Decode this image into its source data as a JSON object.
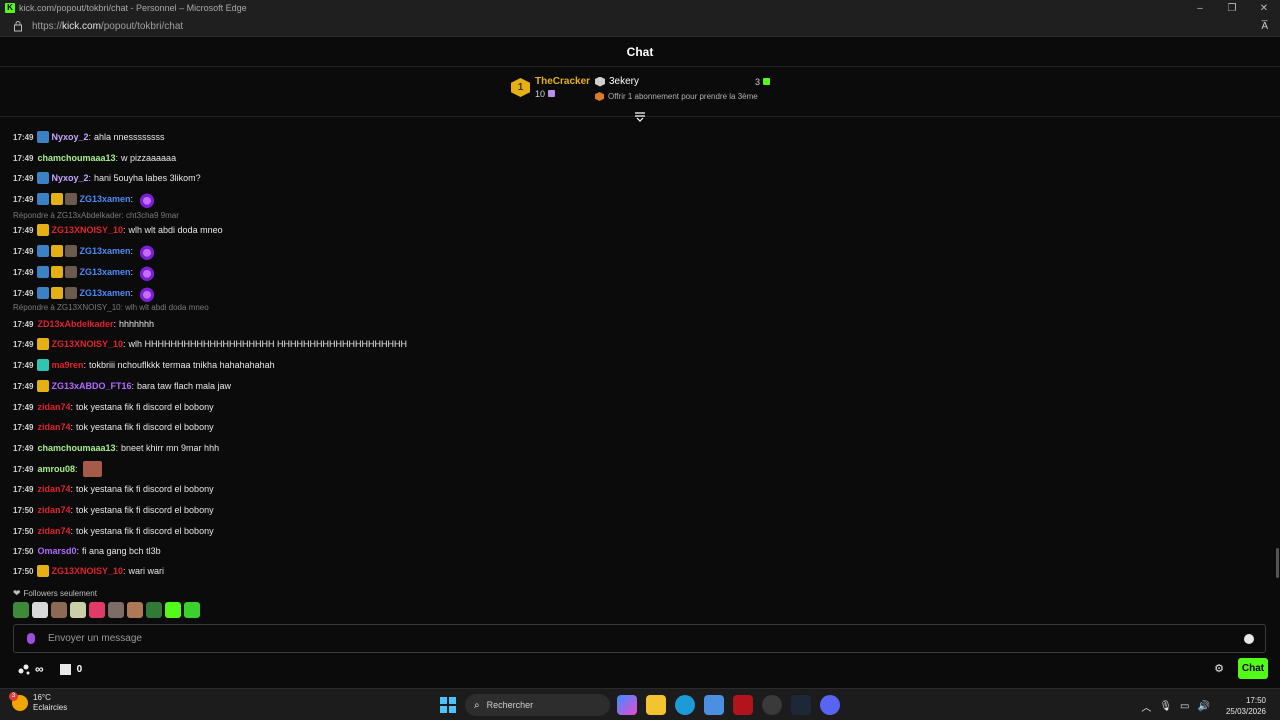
{
  "window": {
    "title": "kick.com/popout/tokbri/chat - Personnel – Microsoft Edge",
    "url_prefix": "https://",
    "url_host": "kick.com",
    "url_path": "/popout/tokbri/chat",
    "read_aloud": "A̅"
  },
  "header": {
    "title": "Chat"
  },
  "pinned": {
    "rank": "1",
    "top_user": "TheCracker",
    "top_count": "10",
    "second_user": "3ekery",
    "second_count": "3",
    "offer_text": "Offrir 1 abonnement pour prendre la 3ème"
  },
  "messages": [
    {
      "time": "17:49",
      "user": "Nyxoy_2",
      "color": "#c6a6ff",
      "badges": [
        "sub"
      ],
      "text": "ahla nnessssssss"
    },
    {
      "time": "17:49",
      "user": "chamchoumaaa13",
      "color": "#a6f08a",
      "badges": [],
      "text": "w pizzaaaaaa"
    },
    {
      "time": "17:49",
      "user": "Nyxoy_2",
      "color": "#c6a6ff",
      "badges": [
        "sub"
      ],
      "text": "hani 5ouyha labes 3likom?"
    },
    {
      "time": "17:49",
      "user": "ZG13xamen",
      "color": "#4c8bf5",
      "badges": [
        "sub",
        "crown",
        "av"
      ],
      "text": "",
      "emote": true
    },
    {
      "reply": "Répondre à ZG13xAbdelkader: cht3cha9 9mar"
    },
    {
      "time": "17:49",
      "user": "ZG13XNOISY_10",
      "color": "#e0242b",
      "badges": [
        "crown"
      ],
      "text": "wlh wlt abdi doda mneo"
    },
    {
      "time": "17:49",
      "user": "ZG13xamen",
      "color": "#4c8bf5",
      "badges": [
        "sub",
        "crown",
        "av"
      ],
      "text": "",
      "emote": true
    },
    {
      "time": "17:49",
      "user": "ZG13xamen",
      "color": "#4c8bf5",
      "badges": [
        "sub",
        "crown",
        "av"
      ],
      "text": "",
      "emote": true
    },
    {
      "time": "17:49",
      "user": "ZG13xamen",
      "color": "#4c8bf5",
      "badges": [
        "sub",
        "crown",
        "av"
      ],
      "text": "",
      "emote": true
    },
    {
      "reply": "Répondre à ZG13XNOISY_10: wlh wlt abdi doda mneo"
    },
    {
      "time": "17:49",
      "user": "ZD13xAbdelkader",
      "color": "#e0242b",
      "badges": [],
      "text": "hhhhhhh"
    },
    {
      "time": "17:49",
      "user": "ZG13XNOISY_10",
      "color": "#e0242b",
      "badges": [
        "crown"
      ],
      "text": "wlh HHHHHHHHHHHHHHHHHHHH HHHHHHHHHHHHHHHHHHHH"
    },
    {
      "time": "17:49",
      "user": "ma9ren",
      "color": "#e0242b",
      "badges": [
        "mod"
      ],
      "text": "tokbriii nchouflkkk termaa tnikha hahahahahah"
    },
    {
      "time": "17:49",
      "user": "ZG13xABDO_FT16",
      "color": "#b26bff",
      "badges": [
        "crown"
      ],
      "text": "bara taw flach mala jaw"
    },
    {
      "time": "17:49",
      "user": "zidan74",
      "color": "#e0242b",
      "badges": [],
      "text": "tok yestana fik fi discord el bobony"
    },
    {
      "time": "17:49",
      "user": "zidan74",
      "color": "#e0242b",
      "badges": [],
      "text": "tok yestana fik fi discord el bobony"
    },
    {
      "time": "17:49",
      "user": "chamchoumaaa13",
      "color": "#a6f08a",
      "badges": [],
      "text": "bneet khirr mn 9mar hhh"
    },
    {
      "time": "17:49",
      "user": "amrou08",
      "color": "#a6f08a",
      "badges": [],
      "text": "",
      "face": true
    },
    {
      "time": "17:49",
      "user": "zidan74",
      "color": "#e0242b",
      "badges": [],
      "text": "tok yestana fik fi discord el bobony"
    },
    {
      "time": "17:50",
      "user": "zidan74",
      "color": "#e0242b",
      "badges": [],
      "text": "tok yestana fik fi discord el bobony"
    },
    {
      "time": "17:50",
      "user": "zidan74",
      "color": "#e0242b",
      "badges": [],
      "text": "tok yestana fik fi discord el bobony"
    },
    {
      "time": "17:50",
      "user": "Omarsd0",
      "color": "#b26bff",
      "badges": [],
      "text": "fi ana gang bch tl3b"
    },
    {
      "time": "17:50",
      "user": "ZG13XNOISY_10",
      "color": "#e0242b",
      "badges": [
        "crown"
      ],
      "text": "wari wari"
    }
  ],
  "footer": {
    "followers_only": "Followers seulement",
    "input_placeholder": "Envoyer un message",
    "gift_count": "0",
    "chat_button": "Chat"
  },
  "taskbar": {
    "temperature": "16°C",
    "weather": "Eclaircies",
    "weather_badge": "3",
    "search": "Rechercher",
    "time": "17:50",
    "date": "25/03/2026"
  },
  "colors": {
    "kick_green": "#53fc18",
    "gold": "#e5b016",
    "background": "#0b0b0c"
  }
}
